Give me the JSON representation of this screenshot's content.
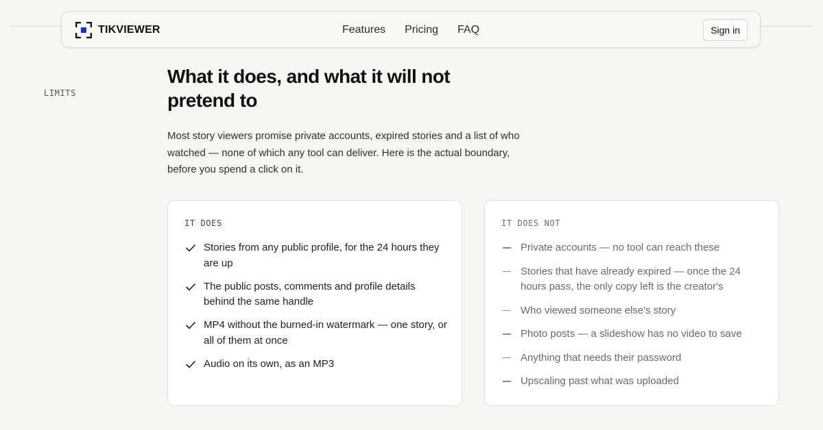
{
  "brand": {
    "name": "TIKVIEWER",
    "accent": "#1f2fd8"
  },
  "nav": {
    "links": [
      "Features",
      "Pricing",
      "FAQ"
    ],
    "signin_label": "Sign in"
  },
  "section": {
    "label": "LIMITS",
    "title": "What it does, and what it will not pretend to",
    "lede": "Most story viewers promise private accounts, expired stories and a list of who watched — none of which any tool can deliver. Here is the actual boundary, before you spend a click on it."
  },
  "does": {
    "heading": "IT DOES",
    "icon": "check-icon",
    "items": [
      "Stories from any public profile, for the 24 hours they are up",
      "The public posts, comments and profile details behind the same handle",
      "MP4 without the burned-in watermark — one story, or all of them at once",
      "Audio on its own, as an MP3"
    ]
  },
  "does_not": {
    "heading": "IT DOES NOT",
    "icon": "dash-icon",
    "items": [
      "Private accounts — no tool can reach these",
      "Stories that have already expired — once the 24 hours pass, the only copy left is the creator's",
      "Who viewed someone else's story",
      "Photo posts — a slideshow has no video to save",
      "Anything that needs their password",
      "Upscaling past what was uploaded"
    ]
  }
}
